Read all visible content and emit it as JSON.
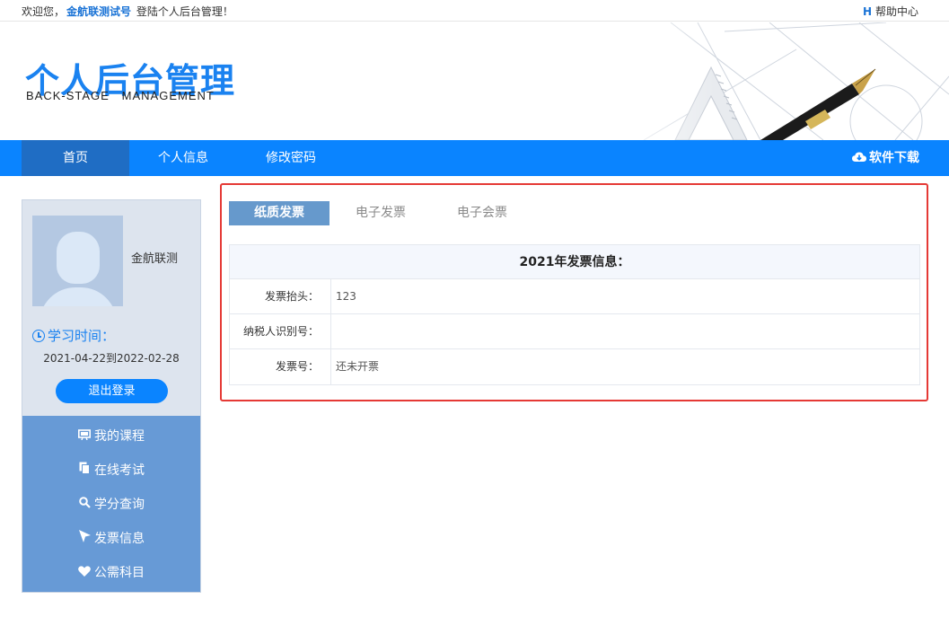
{
  "topbar": {
    "welcome_prefix": "欢迎您，",
    "username": "金航联测试号",
    "welcome_suffix": " 登陆个人后台管理！",
    "help_icon": "H",
    "help_label": "帮助中心"
  },
  "banner": {
    "title_cn": "个人后台管理",
    "title_en": "BACK-STAGE   MANAGEMENT"
  },
  "nav": {
    "items": [
      {
        "label": "首页",
        "active": true
      },
      {
        "label": "个人信息",
        "active": false
      },
      {
        "label": "修改密码",
        "active": false
      }
    ],
    "download_label": "软件下载"
  },
  "sidebar": {
    "user_name": "金航联测",
    "study_time_label": "学习时间：",
    "study_range": "2021-04-22到2022-02-28",
    "logout_label": "退出登录",
    "menu": [
      {
        "icon": "course-icon",
        "label": "我的课程"
      },
      {
        "icon": "exam-icon",
        "label": "在线考试"
      },
      {
        "icon": "search-icon",
        "label": "学分查询"
      },
      {
        "icon": "cursor-icon",
        "label": "发票信息"
      },
      {
        "icon": "heart-icon",
        "label": "公需科目"
      }
    ]
  },
  "content": {
    "tabs": [
      {
        "label": "纸质发票",
        "active": true
      },
      {
        "label": "电子发票",
        "active": false
      },
      {
        "label": "电子会票",
        "active": false
      }
    ],
    "table_title": "2021年发票信息：",
    "rows": [
      {
        "label": "发票抬头：",
        "value": "123"
      },
      {
        "label": "纳税人识别号：",
        "value": ""
      },
      {
        "label": "发票号：",
        "value": "还未开票"
      }
    ]
  },
  "colors": {
    "primary": "#0a84ff",
    "nav_active": "#1f6dc4",
    "sidebar_menu": "#679ad6",
    "highlight_border": "#e53935"
  }
}
